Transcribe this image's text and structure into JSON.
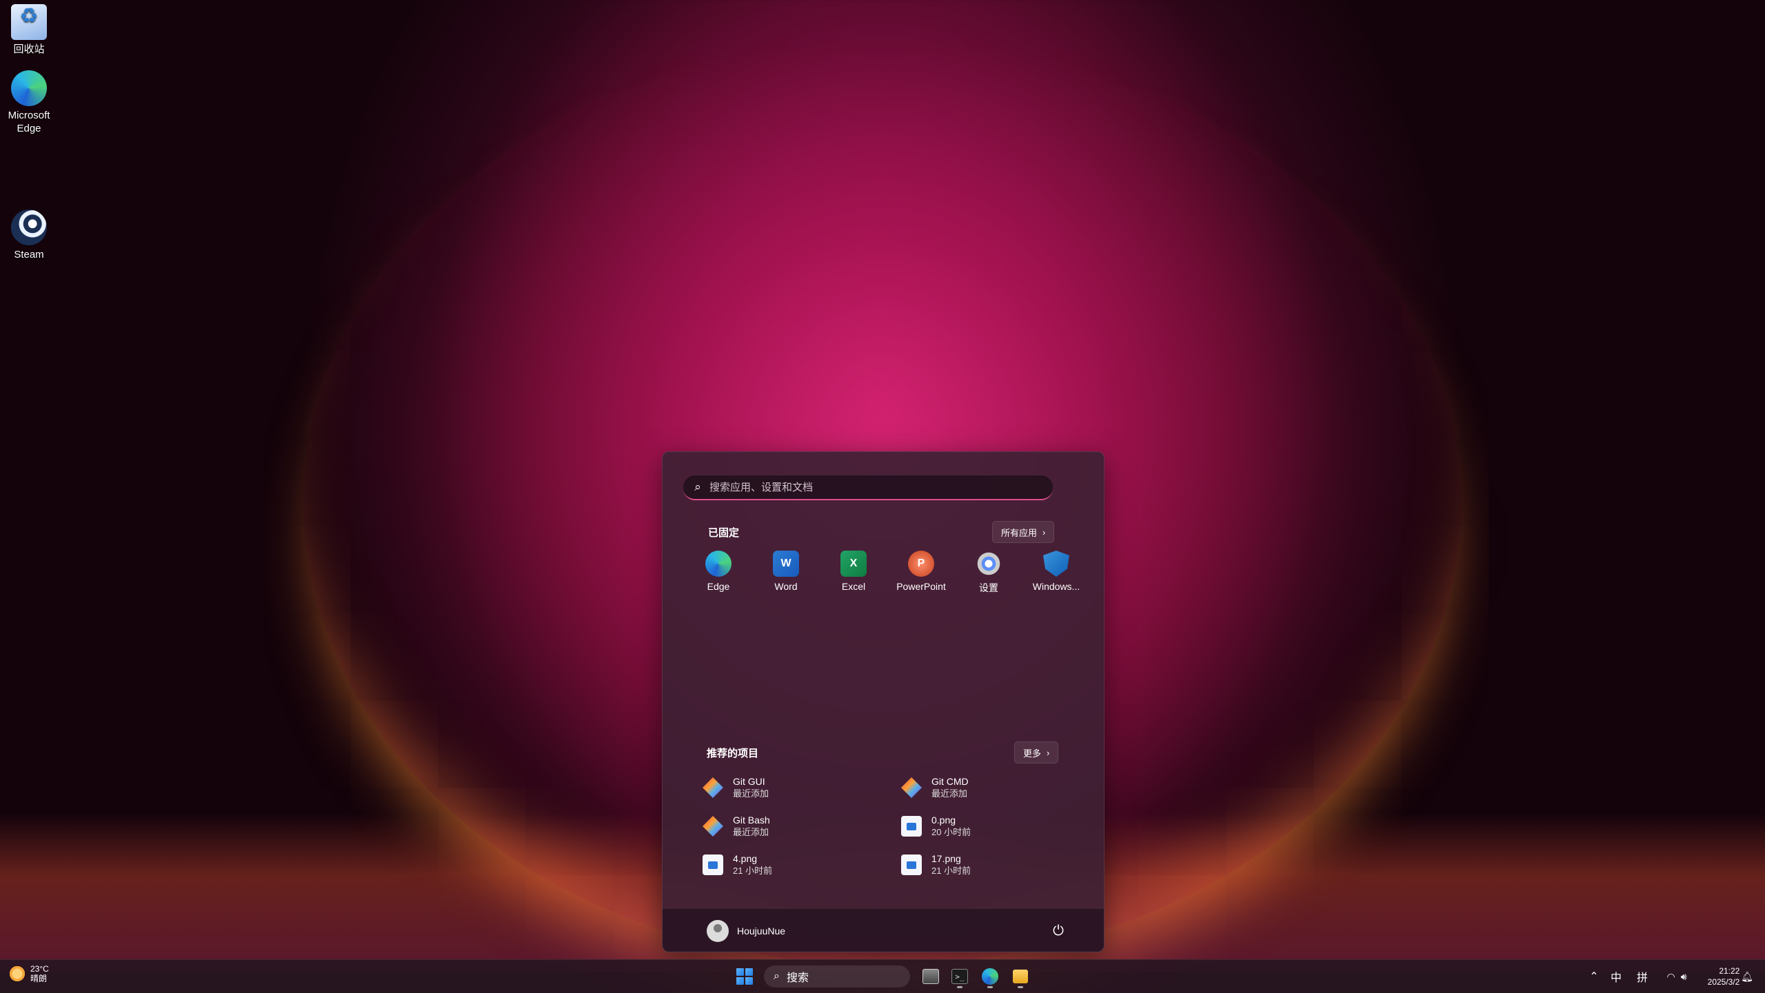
{
  "desktop": {
    "icons": [
      {
        "label": "回收站"
      },
      {
        "label": "Microsoft Edge"
      },
      {
        "label": "Steam"
      }
    ]
  },
  "start_menu": {
    "search_placeholder": "搜索应用、设置和文档",
    "pinned_title": "已固定",
    "all_apps_label": "所有应用",
    "pinned": [
      {
        "label": "Edge",
        "icon": "edge-icon"
      },
      {
        "label": "Word",
        "icon": "word-icon"
      },
      {
        "label": "Excel",
        "icon": "excel-icon"
      },
      {
        "label": "PowerPoint",
        "icon": "powerpoint-icon"
      },
      {
        "label": "设置",
        "icon": "settings-icon"
      },
      {
        "label": "Windows...",
        "icon": "windows-security-icon"
      }
    ],
    "recommended_title": "推荐的项目",
    "more_label": "更多",
    "recommended": [
      {
        "name": "Git GUI",
        "sub": "最近添加"
      },
      {
        "name": "Git CMD",
        "sub": "最近添加"
      },
      {
        "name": "Git Bash",
        "sub": "最近添加"
      },
      {
        "name": "0.png",
        "sub": "20 小时前"
      },
      {
        "name": "4.png",
        "sub": "21 小时前"
      },
      {
        "name": "17.png",
        "sub": "21 小时前"
      }
    ],
    "user_name": "HoujuuNue"
  },
  "taskbar": {
    "weather_temp": "23°C",
    "weather_desc": "晴朗",
    "search_label": "搜索",
    "tray_ime_lang": "中",
    "tray_ime_mode": "拼",
    "time": "21:22",
    "date": "2025/3/2"
  },
  "colors": {
    "accent": "#d94f8a",
    "menu_bg": "#3e2034",
    "taskbar_bg": "#281622"
  }
}
